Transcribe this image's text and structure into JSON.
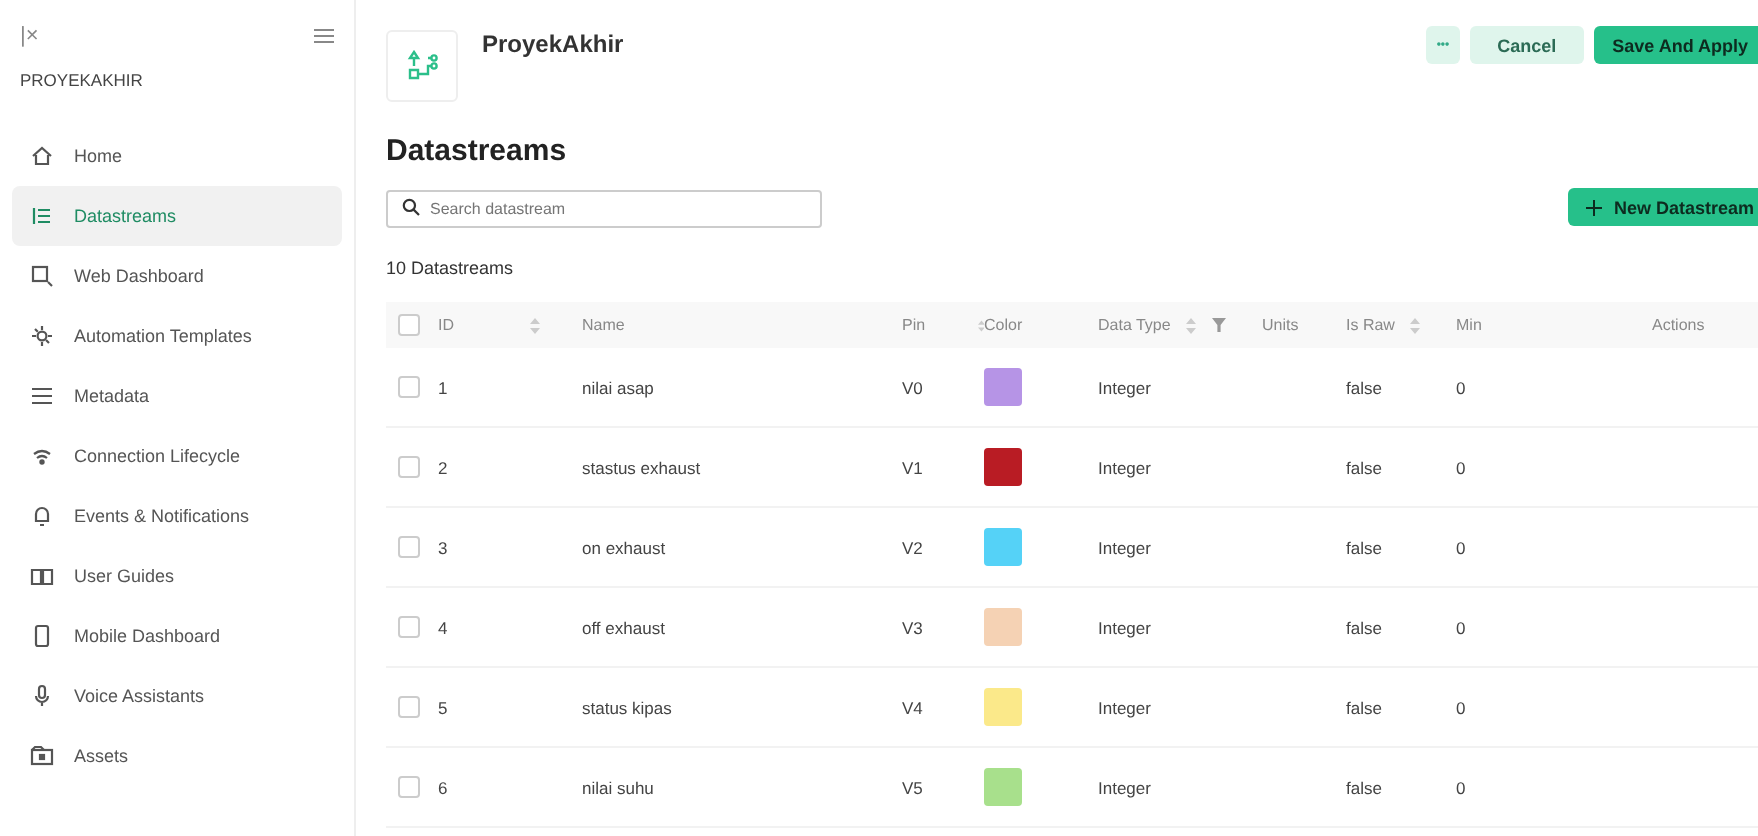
{
  "sidebar": {
    "logo": "|×",
    "org": "PROYEKAKHIR",
    "items": [
      {
        "label": "Home",
        "selected": false
      },
      {
        "label": "Datastreams",
        "selected": true
      },
      {
        "label": "Web Dashboard",
        "selected": false
      },
      {
        "label": "Automation Templates",
        "selected": false
      },
      {
        "label": "Metadata",
        "selected": false
      },
      {
        "label": "Connection Lifecycle",
        "selected": false
      },
      {
        "label": "Events & Notifications",
        "selected": false
      },
      {
        "label": "User Guides",
        "selected": false
      },
      {
        "label": "Mobile Dashboard",
        "selected": false
      },
      {
        "label": "Voice Assistants",
        "selected": false
      },
      {
        "label": "Assets",
        "selected": false
      }
    ]
  },
  "header": {
    "title": "ProyekAkhir",
    "buttons": [
      "•••",
      "Cancel",
      "Save And Apply"
    ]
  },
  "page": {
    "title": "Datastreams",
    "search": {
      "placeholder": "Search datastream"
    },
    "new_button": "New Datastream",
    "count": "10 Datastreams"
  },
  "table": {
    "select_all": {
      "checked": false
    },
    "columns": [
      "ID",
      "Name",
      "Pin",
      "Color",
      "Data Type",
      "Units",
      "Is Raw",
      "Min",
      "Actions"
    ],
    "rows": [
      {
        "checked": false,
        "id": "1",
        "name": "nilai asap",
        "pin": "V0",
        "color": "#b694e6",
        "data_type": "Integer",
        "is_raw": "false",
        "min": "0"
      },
      {
        "checked": false,
        "id": "2",
        "name": "stastus exhaust",
        "pin": "V1",
        "color": "#b91c24",
        "data_type": "Integer",
        "is_raw": "false",
        "min": "0"
      },
      {
        "checked": false,
        "id": "3",
        "name": "on exhaust",
        "pin": "V2",
        "color": "#55d2f7",
        "data_type": "Integer",
        "is_raw": "false",
        "min": "0"
      },
      {
        "checked": false,
        "id": "4",
        "name": "off exhaust",
        "pin": "V3",
        "color": "#f5d2b4",
        "data_type": "Integer",
        "is_raw": "false",
        "min": "0"
      },
      {
        "checked": false,
        "id": "5",
        "name": "status kipas",
        "pin": "V4",
        "color": "#fbe98a",
        "data_type": "Integer",
        "is_raw": "false",
        "min": "0"
      },
      {
        "checked": false,
        "id": "6",
        "name": "nilai suhu",
        "pin": "V5",
        "color": "#a8e08c",
        "data_type": "Integer",
        "is_raw": "false",
        "min": "0"
      }
    ]
  }
}
